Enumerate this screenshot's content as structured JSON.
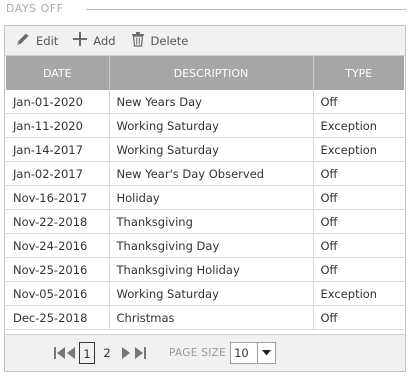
{
  "section": {
    "title": "DAYS OFF"
  },
  "toolbar": {
    "edit_label": "Edit",
    "add_label": "Add",
    "delete_label": "Delete"
  },
  "table": {
    "columns": [
      "DATE",
      "DESCRIPTION",
      "TYPE"
    ],
    "rows": [
      [
        "Jan-01-2020",
        "New Years Day",
        "Off"
      ],
      [
        "Jan-11-2020",
        "Working Saturday",
        "Exception"
      ],
      [
        "Jan-14-2017",
        "Working Saturday",
        "Exception"
      ],
      [
        "Jan-02-2017",
        "New Year's Day Observed",
        "Off"
      ],
      [
        "Nov-16-2017",
        "Holiday",
        "Off"
      ],
      [
        "Nov-22-2018",
        "Thanksgiving",
        "Off"
      ],
      [
        "Nov-24-2016",
        "Thanksgiving Day",
        "Off"
      ],
      [
        "Nov-25-2016",
        "Thanksgiving Holiday",
        "Off"
      ],
      [
        "Nov-05-2016",
        "Working Saturday",
        "Exception"
      ],
      [
        "Dec-25-2018",
        "Christmas",
        "Off"
      ]
    ]
  },
  "pager": {
    "pages": [
      "1",
      "2"
    ],
    "current_page": "1",
    "page_size_label": "PAGE SIZE",
    "page_size_value": "10"
  },
  "colors": {
    "header_bg": "#a6a6a6",
    "toolbar_bg": "#f1f1f1",
    "border": "#c3c3c3"
  },
  "icons": {
    "edit": "pencil-icon",
    "add": "plus-icon",
    "delete": "trash-icon",
    "first": "first-page-icon",
    "prev": "previous-page-icon",
    "next": "next-page-icon",
    "last": "last-page-icon",
    "dropdown": "chevron-down-icon"
  }
}
